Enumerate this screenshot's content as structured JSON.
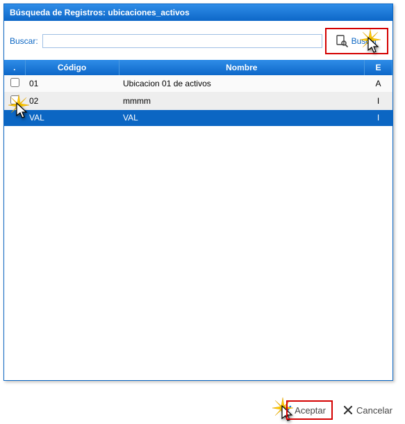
{
  "window": {
    "title": "Búsqueda de Registros: ubicaciones_activos"
  },
  "search": {
    "label": "Buscar:",
    "value": "",
    "placeholder": "",
    "button": "Buscar"
  },
  "table": {
    "headers": {
      "sel": ".",
      "code": "Código",
      "name": "Nombre",
      "e": "E"
    },
    "rows": [
      {
        "code": "01",
        "name": "Ubicacion 01 de activos",
        "e": "A",
        "selected": false
      },
      {
        "code": "02",
        "name": "mmmm",
        "e": "I",
        "selected": false
      },
      {
        "code": "VAL",
        "name": "VAL",
        "e": "I",
        "selected": true
      }
    ]
  },
  "footer": {
    "accept": "Aceptar",
    "cancel": "Cancelar"
  },
  "colors": {
    "primary": "#0b66c3",
    "highlight_red": "#d40000"
  }
}
